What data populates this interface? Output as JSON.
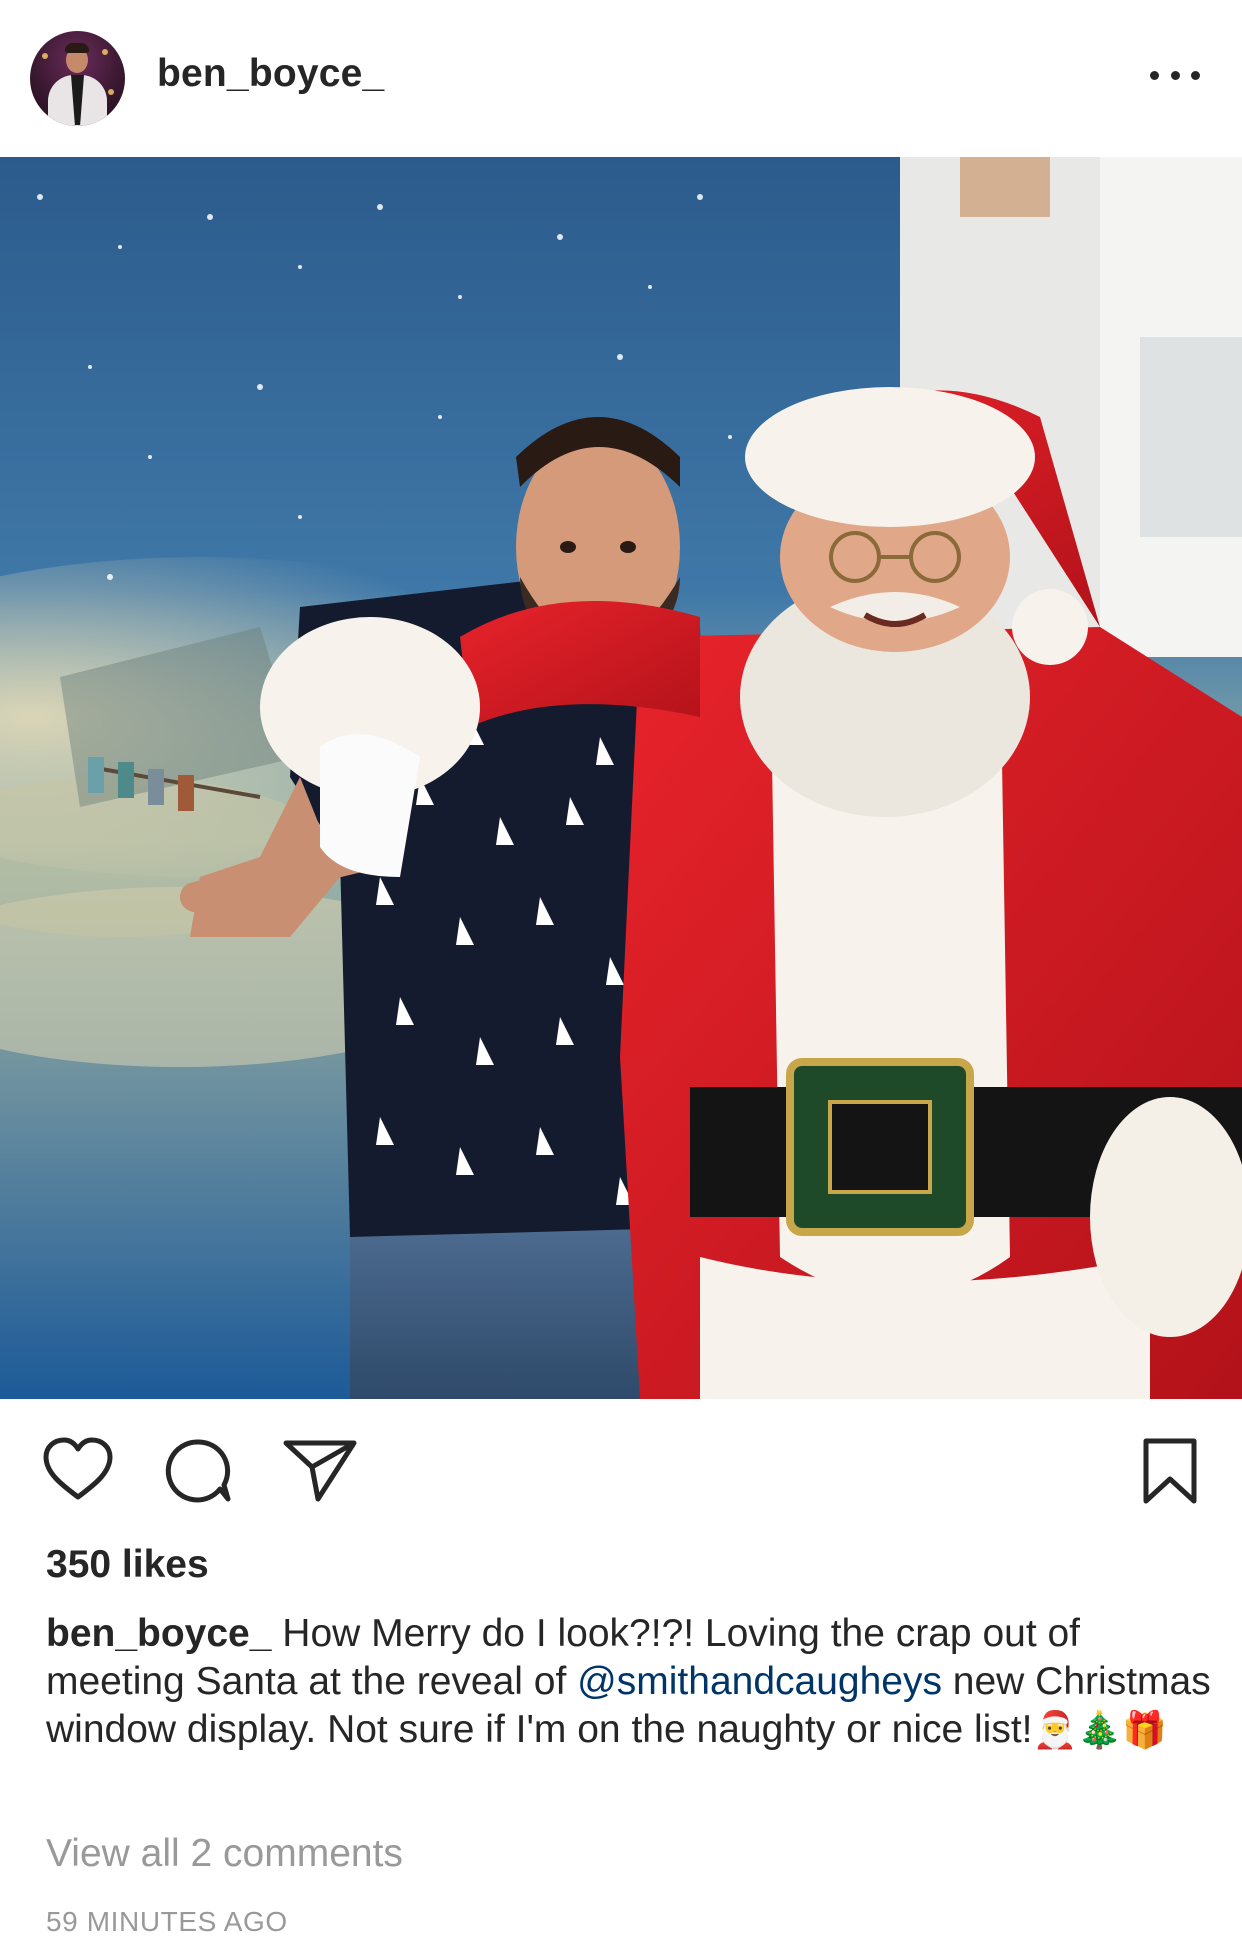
{
  "post": {
    "username": "ben_boyce_",
    "avatar_icon": "profile-avatar",
    "more_icon": "more-options-icon"
  },
  "photo": {
    "icon": "post-photo"
  },
  "actions": {
    "like_icon": "heart-icon",
    "comment_icon": "comment-icon",
    "share_icon": "share-icon",
    "save_icon": "bookmark-icon"
  },
  "likes_text": "350 likes",
  "caption": {
    "username": "ben_boyce_",
    "text_part1": " How Merry do I look?!?! Loving the crap out of meeting Santa at the reveal of ",
    "mention": "@smithandcaugheys",
    "text_part2": " new Christmas window display. Not sure if I'm on the naughty or nice list!",
    "emojis": "🎅🎄🎁"
  },
  "view_comments": "View all 2 comments",
  "timestamp": "59 MINUTES AGO",
  "colors": {
    "text": "#262626",
    "secondary_text": "#999999",
    "mention": "#003569",
    "divider": "#e6e6e6"
  }
}
